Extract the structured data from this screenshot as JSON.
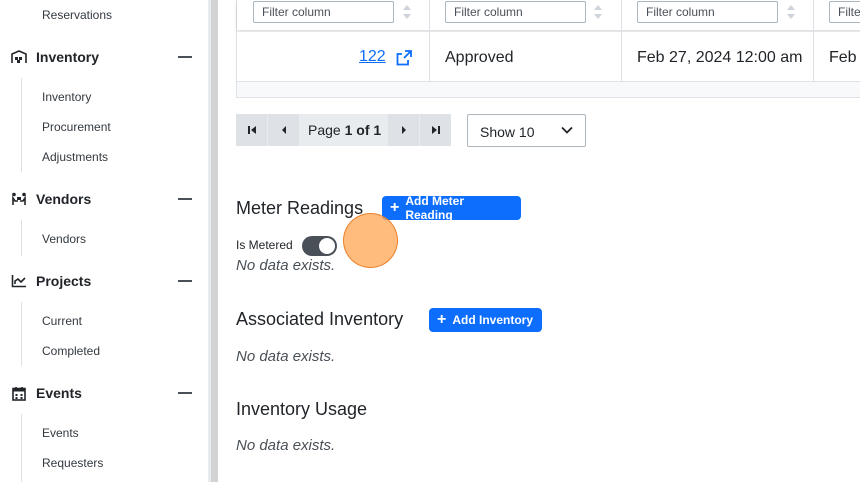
{
  "sidebar": {
    "top_item": "Reservations",
    "sections": [
      {
        "label": "Inventory",
        "icon": "warehouse-icon",
        "items": [
          "Inventory",
          "Procurement",
          "Adjustments"
        ]
      },
      {
        "label": "Vendors",
        "icon": "people-carry-icon",
        "items": [
          "Vendors"
        ]
      },
      {
        "label": "Projects",
        "icon": "chart-icon",
        "items": [
          "Current",
          "Completed"
        ]
      },
      {
        "label": "Events",
        "icon": "calendar-icon",
        "items": [
          "Events",
          "Requesters"
        ]
      }
    ]
  },
  "table": {
    "filter_placeholder": "Filter column",
    "filter_placeholder_short": "Filte",
    "row": {
      "id": "122",
      "status": "Approved",
      "date": "Feb 27, 2024 12:00 am",
      "date_cut": "Feb"
    }
  },
  "pagination": {
    "page_prefix": "Page",
    "page_current": "1 of 1",
    "show": "Show 10"
  },
  "meter": {
    "title": "Meter Readings",
    "add_button": "Add Meter Reading",
    "toggle_label": "Is Metered",
    "toggle_on": true,
    "empty": "No data exists."
  },
  "associated": {
    "title": "Associated Inventory",
    "add_button": "Add Inventory",
    "empty": "No data exists."
  },
  "usage": {
    "title": "Inventory Usage",
    "empty": "No data exists."
  },
  "colors": {
    "primary": "#0d6efd",
    "toggle": "#495057",
    "cursor": "#ffa550"
  }
}
